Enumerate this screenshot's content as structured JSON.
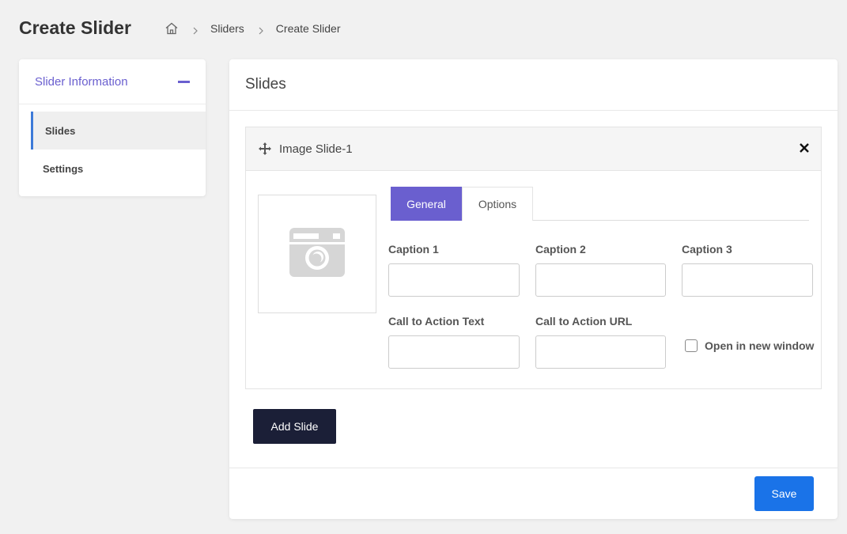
{
  "page": {
    "title": "Create Slider"
  },
  "breadcrumb": {
    "home_icon": "home-icon",
    "separator_icon": "chevron-right-icon",
    "items": [
      "Sliders",
      "Create Slider"
    ]
  },
  "sidebar": {
    "header_title": "Slider Information",
    "collapse_icon": "minus-icon",
    "items": [
      {
        "label": "Slides",
        "active": true
      },
      {
        "label": "Settings",
        "active": false
      }
    ]
  },
  "main": {
    "title": "Slides",
    "slide": {
      "title": "Image Slide-1",
      "move_icon": "move-icon",
      "close_icon": "close-icon",
      "image_placeholder_icon": "camera-icon",
      "tabs": [
        {
          "label": "General",
          "active": true
        },
        {
          "label": "Options",
          "active": false
        }
      ],
      "fields": {
        "caption1": {
          "label": "Caption 1",
          "value": ""
        },
        "caption2": {
          "label": "Caption 2",
          "value": ""
        },
        "caption3": {
          "label": "Caption 3",
          "value": ""
        },
        "cta_text": {
          "label": "Call to Action Text",
          "value": ""
        },
        "cta_url": {
          "label": "Call to Action URL",
          "value": ""
        }
      },
      "open_new_window": {
        "label": "Open in new window",
        "checked": false
      }
    },
    "add_slide_label": "Add Slide",
    "save_label": "Save"
  },
  "colors": {
    "accent": "#6a5fcf",
    "primary_button": "#1a73e8",
    "dark_button": "#1b1f37",
    "active_indicator": "#3d7ad8"
  }
}
